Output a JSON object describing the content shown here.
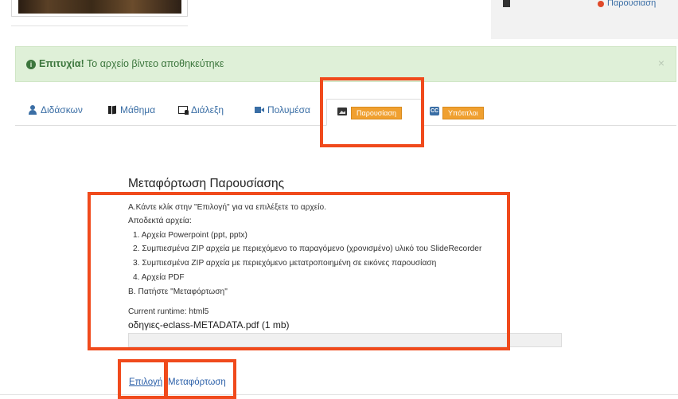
{
  "header": {
    "right_link": "Παρουσίαση"
  },
  "alert": {
    "strong": "Επιτυχία!",
    "message": " Το αρχείο βίντεο αποθηκεύτηκε",
    "close": "×"
  },
  "tabs": [
    {
      "label": "Διδάσκων"
    },
    {
      "label": "Μάθημα"
    },
    {
      "label": "Διάλεξη"
    },
    {
      "label": "Πολυμέσα"
    },
    {
      "label": "Παρουσίαση",
      "active": true
    },
    {
      "label": "Υπότιτλοι"
    }
  ],
  "cc_icon_text": "CC",
  "upload": {
    "heading": "Μεταφόρτωση Παρουσίασης",
    "step_a": "Α.Κάντε κλίκ στην \"Επιλογή\" για να επιλέξετε το αρχείο.",
    "accepted": "Αποδεκτά αρχεία:",
    "items": [
      "1. Αρχεία Powerpoint (ppt, pptx)",
      "2. Συμπιεσμένα ZIP αρχεία με περιεχόμενο το παραγόμενο (χρονισμένο) υλικό του SlideRecorder",
      "3. Συμπιεσμένα ZIP αρχεία με περιεχόμενο μετατροποιημένη σε εικόνες παρουσίαση",
      "4. Αρχεία PDF"
    ],
    "step_b": "Β. Πατήστε \"Μεταφόρτωση\"",
    "runtime": "Current runtime: html5",
    "file_name": "οδηγιες-eclass-METADATA.pdf (1 mb)",
    "progress": 0
  },
  "actions": {
    "select": "Επιλογή",
    "upload": "Μεταφόρτωση"
  },
  "colors": {
    "highlight_box": "#f04a1c",
    "link": "#2a5fa8",
    "alert_bg": "#dff0d8",
    "active_tab_pill": "#f0a030"
  }
}
